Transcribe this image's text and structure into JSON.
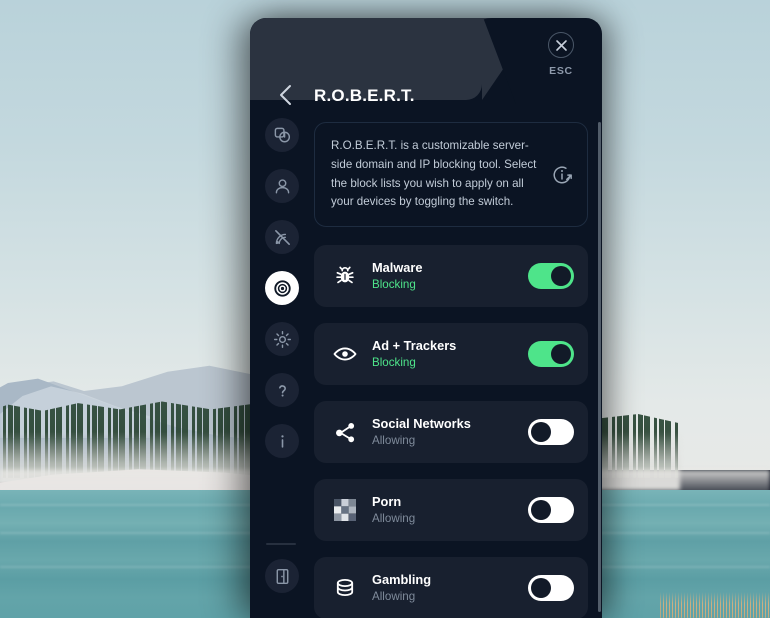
{
  "window": {
    "title": "R.O.B.E.R.T.",
    "back_icon": "chevron-left-icon",
    "close_icon": "close-icon",
    "esc_label": "ESC"
  },
  "colors": {
    "panel_bg": "#0b1423",
    "header_bg": "#2b3340",
    "card_bg": "#18202f",
    "toggle_on": "#4ee48a",
    "toggle_off": "#ffffff",
    "status_on_text": "#4ee48a",
    "status_off_text": "#7f8b9b"
  },
  "sidebar": {
    "items": [
      {
        "name": "devices-icon",
        "active": false
      },
      {
        "name": "account-icon",
        "active": false
      },
      {
        "name": "connection-off-icon",
        "active": false
      },
      {
        "name": "robert-target-icon",
        "active": true
      },
      {
        "name": "settings-gear-icon",
        "active": false
      },
      {
        "name": "help-question-icon",
        "active": false
      },
      {
        "name": "info-icon",
        "active": false
      }
    ],
    "bottom_item": {
      "name": "logout-door-icon"
    }
  },
  "info": {
    "text": "R.O.B.E.R.T. is a customizable server-side domain and IP blocking tool. Select the block lists you wish to apply on all your devices by toggling the switch.",
    "icon": "info-external-link-icon"
  },
  "blocklists": [
    {
      "icon": "bug-icon",
      "title": "Malware",
      "status": "Blocking",
      "enabled": true
    },
    {
      "icon": "eye-icon",
      "title": "Ad + Trackers",
      "status": "Blocking",
      "enabled": true
    },
    {
      "icon": "share-network-icon",
      "title": "Social Networks",
      "status": "Allowing",
      "enabled": false
    },
    {
      "icon": "pixelated-censor-icon",
      "title": "Porn",
      "status": "Allowing",
      "enabled": false
    },
    {
      "icon": "database-chips-icon",
      "title": "Gambling",
      "status": "Allowing",
      "enabled": false
    }
  ]
}
